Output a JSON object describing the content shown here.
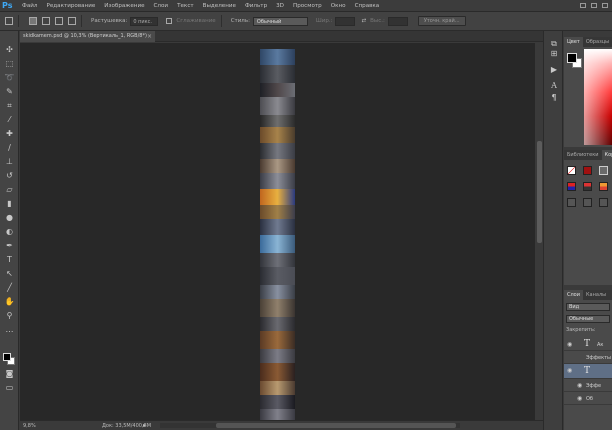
{
  "app": {
    "logo": "Ps",
    "menu": [
      "Файл",
      "Редактирование",
      "Изображение",
      "Слои",
      "Текст",
      "Выделение",
      "Фильтр",
      "3D",
      "Просмотр",
      "Окно",
      "Справка"
    ]
  },
  "options_bar": {
    "feather_label": "Растушевка:",
    "feather_value": "0 пикс.",
    "antialias_label": "Сглаживание",
    "style_label": "Стиль:",
    "style_value": "Обычный",
    "width_label": "Шир.:",
    "height_label": "Выс.:",
    "refine_button": "Уточн. край..."
  },
  "document": {
    "tab_title": "skidkamem.psd @ 10,3% (Вертикаль_1, RGB/8*)",
    "close": "×"
  },
  "status": {
    "zoom": "9,8%",
    "doc_info": "Док: 33,5M/400,8M"
  },
  "panels": {
    "color_tabs": [
      "Цвет",
      "Образцы"
    ],
    "library_tabs": [
      "Библиотеки",
      "Корр"
    ],
    "layers_tabs": [
      "Слои",
      "Каналы"
    ],
    "layers_kind": "Вид",
    "layers_blend": "Обычные",
    "layers_lock": "Закрепить:",
    "layers": [
      {
        "name": "Ак",
        "type": "text",
        "selected": false
      },
      {
        "name": "Эффекты",
        "type": "effect",
        "selected": false
      },
      {
        "name": "",
        "type": "text",
        "selected": true
      },
      {
        "name": "Эффе",
        "type": "effect",
        "selected": false
      },
      {
        "name": "Об",
        "type": "effect",
        "selected": false
      }
    ]
  },
  "colors": {
    "accent": "#3fa9f5",
    "canvas_bg": "#282828",
    "selection": "#5f6f86"
  }
}
